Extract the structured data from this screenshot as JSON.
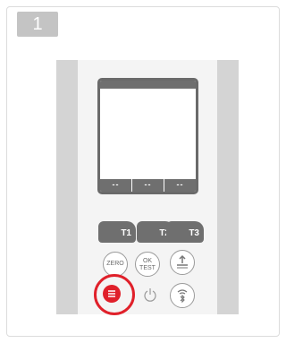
{
  "step": {
    "number": "1"
  },
  "display": {
    "segments": [
      "--",
      "--",
      "--"
    ]
  },
  "buttons": {
    "t1": "T1",
    "t2": "T2",
    "t3": "T3",
    "zero": "ZERO",
    "ok": "OK",
    "test": "TEST",
    "menu_icon": "menu-lines-icon",
    "power_icon": "power-icon",
    "leveler_icon": "up-arrow-levels-icon",
    "wireless_icon": "wifi-bluetooth-icon"
  },
  "colors": {
    "highlight": "#e0202a",
    "display_frame": "#6f6f6f"
  }
}
